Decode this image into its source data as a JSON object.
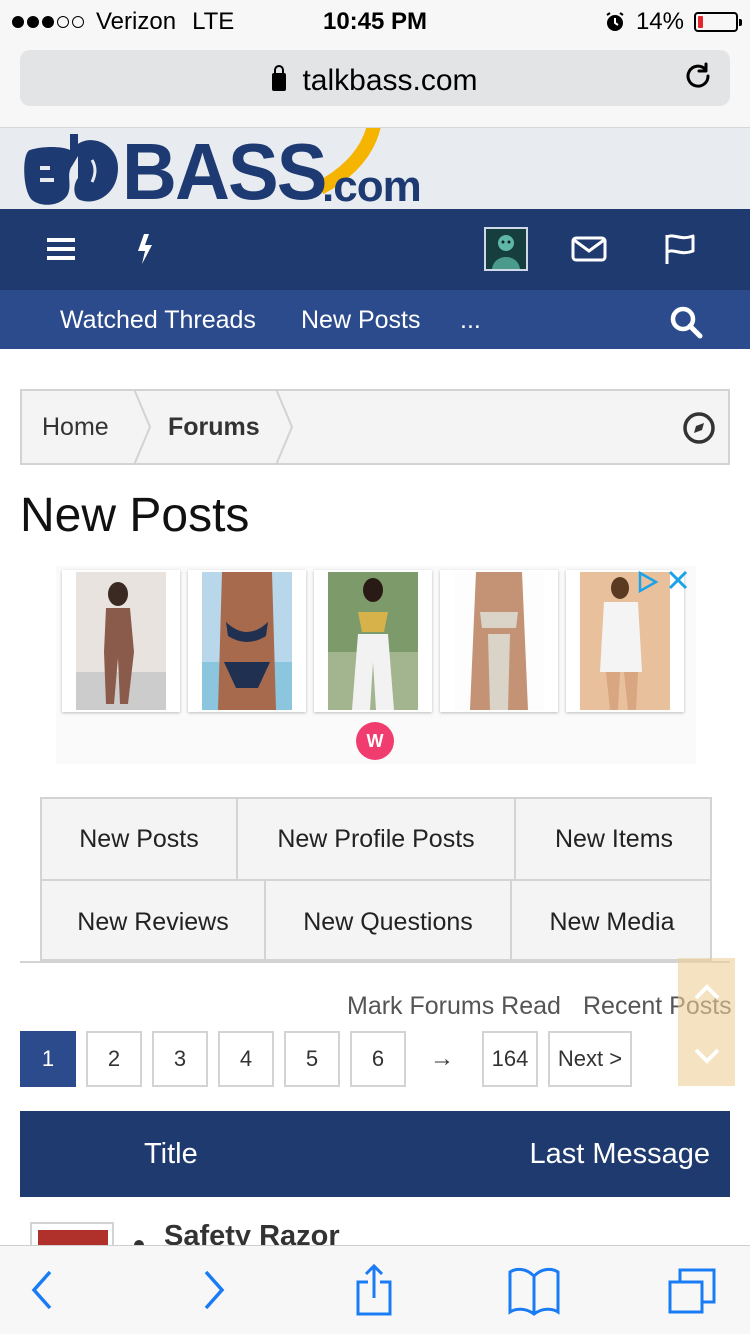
{
  "status": {
    "carrier": "Verizon",
    "network": "LTE",
    "time": "10:45 PM",
    "battery": "14%",
    "battery_level": 0.14,
    "signal_bars_filled": 3
  },
  "browser": {
    "url": "talkbass.com"
  },
  "logo": {
    "word": "BASS",
    "suffix": ".com"
  },
  "nav": {
    "sub_items": [
      "Watched Threads",
      "New Posts",
      "..."
    ]
  },
  "breadcrumb": {
    "home": "Home",
    "forums": "Forums"
  },
  "page": {
    "title": "New Posts"
  },
  "ad": {
    "badge": "W"
  },
  "tabs": {
    "row1": [
      "New Posts",
      "New Profile Posts",
      "New Items"
    ],
    "row2": [
      "New Reviews",
      "New Questions",
      "New Media"
    ]
  },
  "links": {
    "mark_read": "Mark Forums Read",
    "recent": "Recent Posts"
  },
  "pagination": {
    "pages": [
      "1",
      "2",
      "3",
      "4",
      "5",
      "6"
    ],
    "arrow": "→",
    "last": "164",
    "next": "Next >",
    "current": "1"
  },
  "table": {
    "col_title": "Title",
    "col_last": "Last Message"
  },
  "threads": [
    {
      "title": "Safety Razor"
    }
  ],
  "colors": {
    "nav_dark": "#1f3a6e",
    "nav_sub": "#2c4b8d",
    "ios_blue": "#1a7cf5"
  }
}
